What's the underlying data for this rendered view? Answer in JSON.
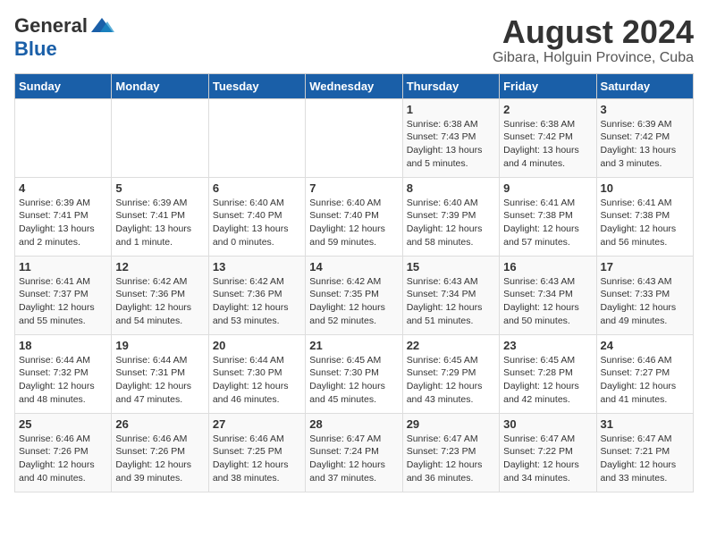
{
  "header": {
    "logo_general": "General",
    "logo_blue": "Blue",
    "month_title": "August 2024",
    "location": "Gibara, Holguin Province, Cuba"
  },
  "weekdays": [
    "Sunday",
    "Monday",
    "Tuesday",
    "Wednesday",
    "Thursday",
    "Friday",
    "Saturday"
  ],
  "weeks": [
    [
      {
        "day": "",
        "text": ""
      },
      {
        "day": "",
        "text": ""
      },
      {
        "day": "",
        "text": ""
      },
      {
        "day": "",
        "text": ""
      },
      {
        "day": "1",
        "text": "Sunrise: 6:38 AM\nSunset: 7:43 PM\nDaylight: 13 hours\nand 5 minutes."
      },
      {
        "day": "2",
        "text": "Sunrise: 6:38 AM\nSunset: 7:42 PM\nDaylight: 13 hours\nand 4 minutes."
      },
      {
        "day": "3",
        "text": "Sunrise: 6:39 AM\nSunset: 7:42 PM\nDaylight: 13 hours\nand 3 minutes."
      }
    ],
    [
      {
        "day": "4",
        "text": "Sunrise: 6:39 AM\nSunset: 7:41 PM\nDaylight: 13 hours\nand 2 minutes."
      },
      {
        "day": "5",
        "text": "Sunrise: 6:39 AM\nSunset: 7:41 PM\nDaylight: 13 hours\nand 1 minute."
      },
      {
        "day": "6",
        "text": "Sunrise: 6:40 AM\nSunset: 7:40 PM\nDaylight: 13 hours\nand 0 minutes."
      },
      {
        "day": "7",
        "text": "Sunrise: 6:40 AM\nSunset: 7:40 PM\nDaylight: 12 hours\nand 59 minutes."
      },
      {
        "day": "8",
        "text": "Sunrise: 6:40 AM\nSunset: 7:39 PM\nDaylight: 12 hours\nand 58 minutes."
      },
      {
        "day": "9",
        "text": "Sunrise: 6:41 AM\nSunset: 7:38 PM\nDaylight: 12 hours\nand 57 minutes."
      },
      {
        "day": "10",
        "text": "Sunrise: 6:41 AM\nSunset: 7:38 PM\nDaylight: 12 hours\nand 56 minutes."
      }
    ],
    [
      {
        "day": "11",
        "text": "Sunrise: 6:41 AM\nSunset: 7:37 PM\nDaylight: 12 hours\nand 55 minutes."
      },
      {
        "day": "12",
        "text": "Sunrise: 6:42 AM\nSunset: 7:36 PM\nDaylight: 12 hours\nand 54 minutes."
      },
      {
        "day": "13",
        "text": "Sunrise: 6:42 AM\nSunset: 7:36 PM\nDaylight: 12 hours\nand 53 minutes."
      },
      {
        "day": "14",
        "text": "Sunrise: 6:42 AM\nSunset: 7:35 PM\nDaylight: 12 hours\nand 52 minutes."
      },
      {
        "day": "15",
        "text": "Sunrise: 6:43 AM\nSunset: 7:34 PM\nDaylight: 12 hours\nand 51 minutes."
      },
      {
        "day": "16",
        "text": "Sunrise: 6:43 AM\nSunset: 7:34 PM\nDaylight: 12 hours\nand 50 minutes."
      },
      {
        "day": "17",
        "text": "Sunrise: 6:43 AM\nSunset: 7:33 PM\nDaylight: 12 hours\nand 49 minutes."
      }
    ],
    [
      {
        "day": "18",
        "text": "Sunrise: 6:44 AM\nSunset: 7:32 PM\nDaylight: 12 hours\nand 48 minutes."
      },
      {
        "day": "19",
        "text": "Sunrise: 6:44 AM\nSunset: 7:31 PM\nDaylight: 12 hours\nand 47 minutes."
      },
      {
        "day": "20",
        "text": "Sunrise: 6:44 AM\nSunset: 7:30 PM\nDaylight: 12 hours\nand 46 minutes."
      },
      {
        "day": "21",
        "text": "Sunrise: 6:45 AM\nSunset: 7:30 PM\nDaylight: 12 hours\nand 45 minutes."
      },
      {
        "day": "22",
        "text": "Sunrise: 6:45 AM\nSunset: 7:29 PM\nDaylight: 12 hours\nand 43 minutes."
      },
      {
        "day": "23",
        "text": "Sunrise: 6:45 AM\nSunset: 7:28 PM\nDaylight: 12 hours\nand 42 minutes."
      },
      {
        "day": "24",
        "text": "Sunrise: 6:46 AM\nSunset: 7:27 PM\nDaylight: 12 hours\nand 41 minutes."
      }
    ],
    [
      {
        "day": "25",
        "text": "Sunrise: 6:46 AM\nSunset: 7:26 PM\nDaylight: 12 hours\nand 40 minutes."
      },
      {
        "day": "26",
        "text": "Sunrise: 6:46 AM\nSunset: 7:26 PM\nDaylight: 12 hours\nand 39 minutes."
      },
      {
        "day": "27",
        "text": "Sunrise: 6:46 AM\nSunset: 7:25 PM\nDaylight: 12 hours\nand 38 minutes."
      },
      {
        "day": "28",
        "text": "Sunrise: 6:47 AM\nSunset: 7:24 PM\nDaylight: 12 hours\nand 37 minutes."
      },
      {
        "day": "29",
        "text": "Sunrise: 6:47 AM\nSunset: 7:23 PM\nDaylight: 12 hours\nand 36 minutes."
      },
      {
        "day": "30",
        "text": "Sunrise: 6:47 AM\nSunset: 7:22 PM\nDaylight: 12 hours\nand 34 minutes."
      },
      {
        "day": "31",
        "text": "Sunrise: 6:47 AM\nSunset: 7:21 PM\nDaylight: 12 hours\nand 33 minutes."
      }
    ]
  ]
}
